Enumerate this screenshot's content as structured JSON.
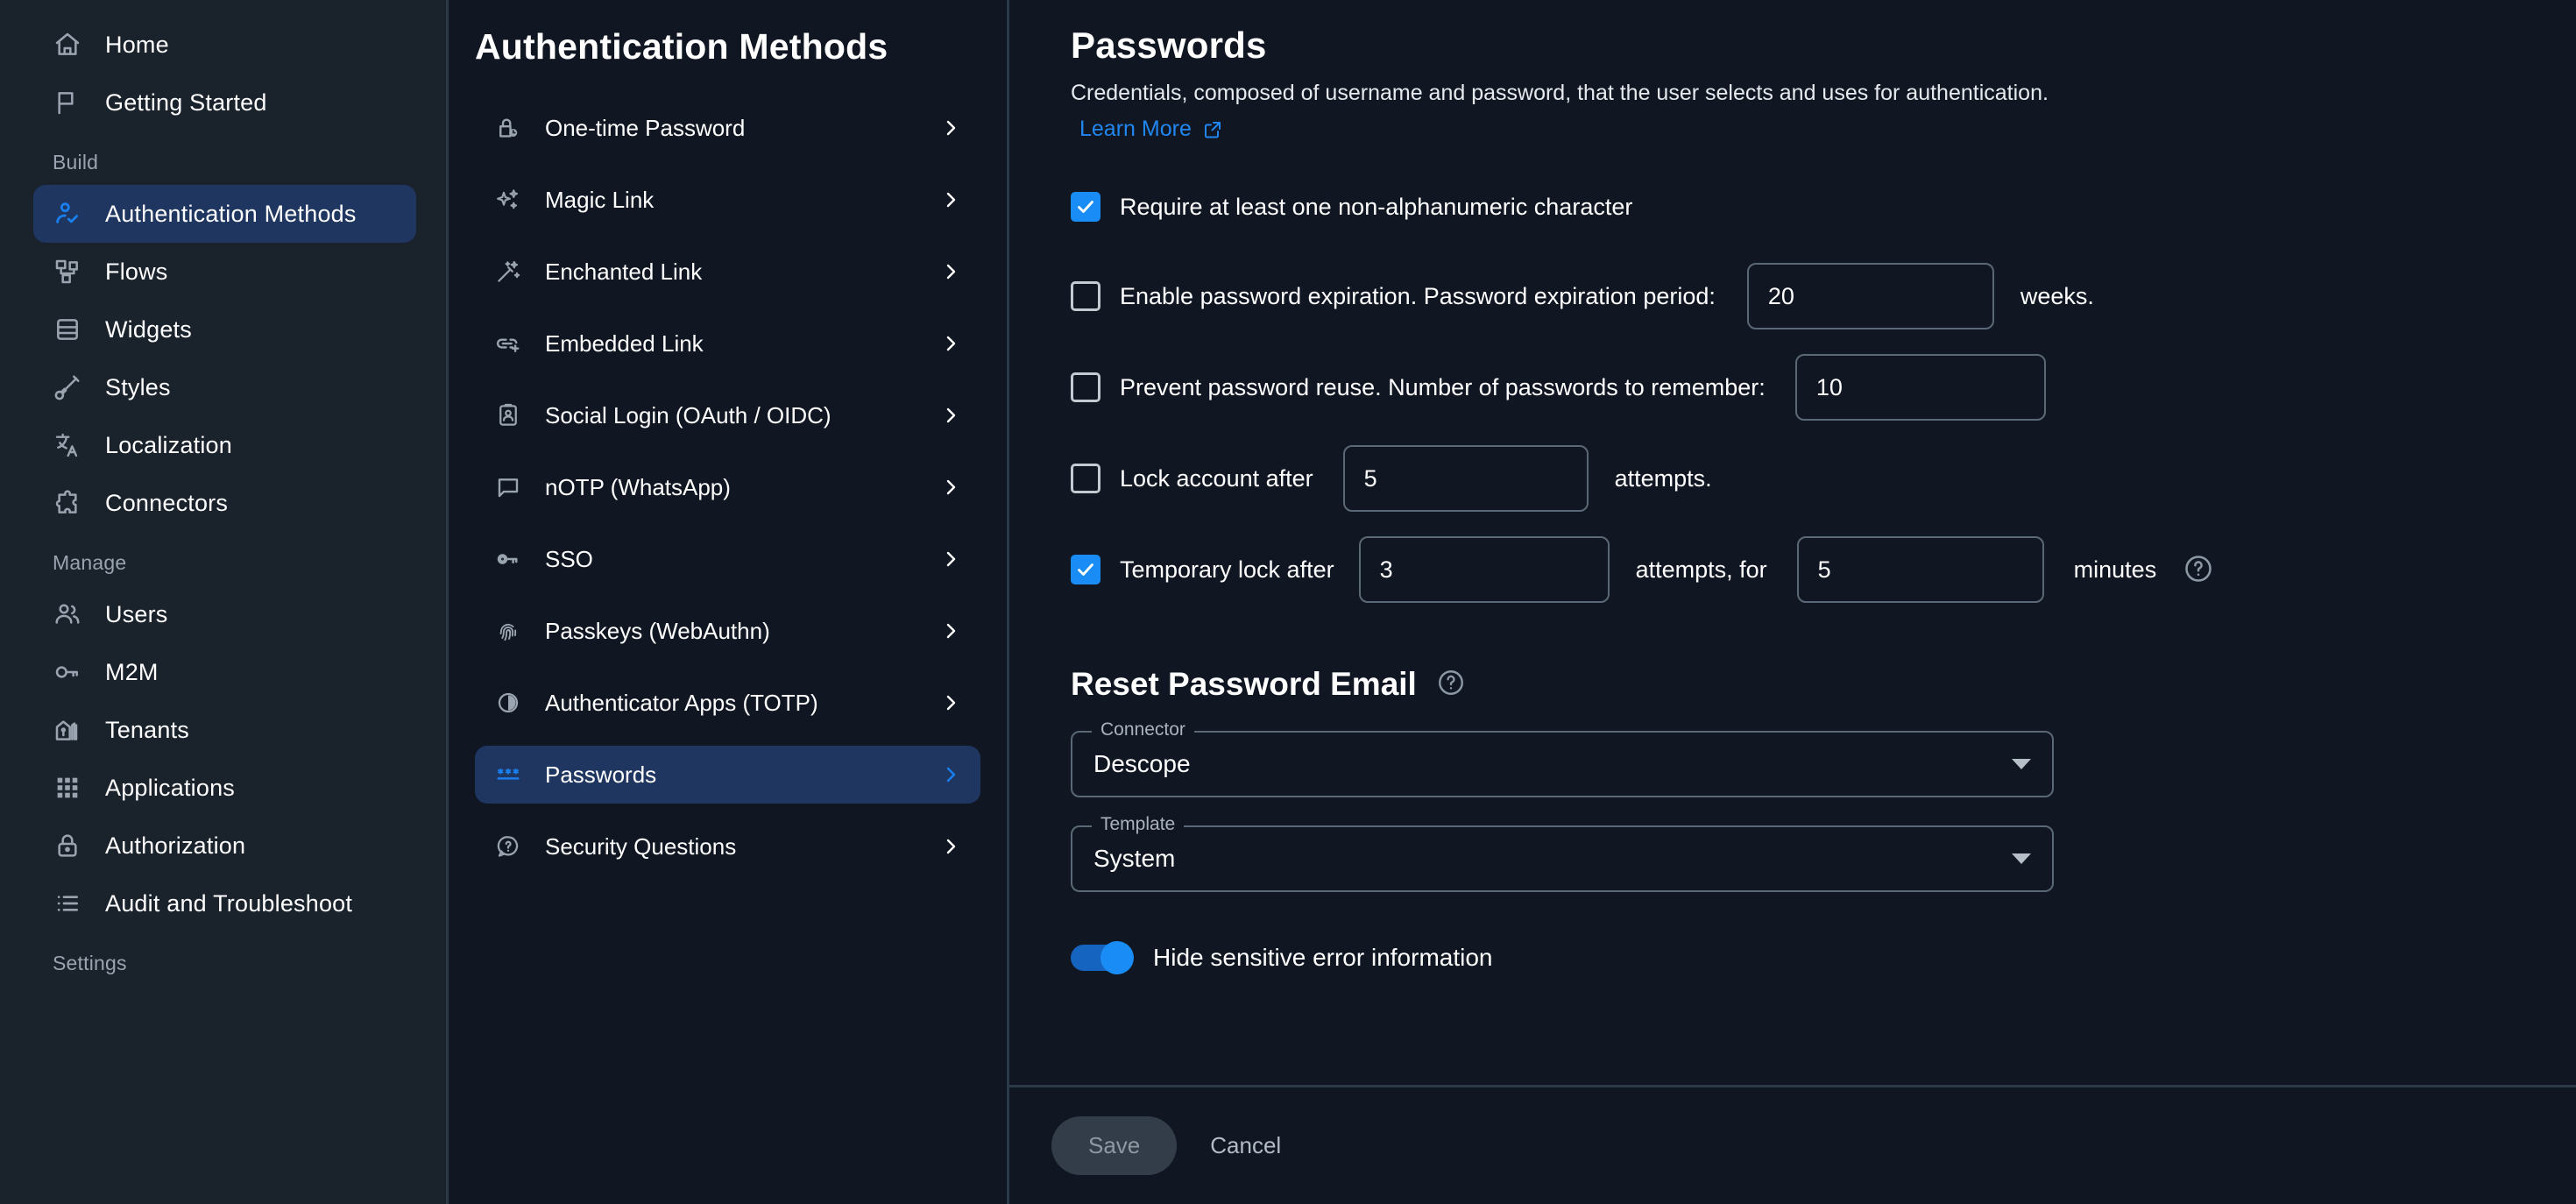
{
  "theme": {
    "sidebar_bg": "#1a222c",
    "main_bg": "#101722",
    "accent": "#1a8cf5",
    "active_item_bg": "#1e3660",
    "link": "#2186f0",
    "border": "#2c3a47"
  },
  "sidebar": {
    "top_items": [
      {
        "label": "Home",
        "icon": "home-icon"
      },
      {
        "label": "Getting Started",
        "icon": "flag-icon"
      }
    ],
    "sections": [
      {
        "title": "Build",
        "items": [
          {
            "label": "Authentication Methods",
            "icon": "user-check-icon",
            "active": true
          },
          {
            "label": "Flows",
            "icon": "flows-icon",
            "active": false
          },
          {
            "label": "Widgets",
            "icon": "widgets-icon",
            "active": false
          },
          {
            "label": "Styles",
            "icon": "brush-icon",
            "active": false
          },
          {
            "label": "Localization",
            "icon": "translate-icon",
            "active": false
          },
          {
            "label": "Connectors",
            "icon": "puzzle-icon",
            "active": false
          }
        ]
      },
      {
        "title": "Manage",
        "items": [
          {
            "label": "Users",
            "icon": "users-icon",
            "active": false
          },
          {
            "label": "M2M",
            "icon": "key-icon",
            "active": false
          },
          {
            "label": "Tenants",
            "icon": "buildings-icon",
            "active": false
          },
          {
            "label": "Applications",
            "icon": "grid-dots-icon",
            "active": false
          },
          {
            "label": "Authorization",
            "icon": "lock-icon",
            "active": false
          },
          {
            "label": "Audit and Troubleshoot",
            "icon": "list-icon",
            "active": false
          }
        ]
      },
      {
        "title": "Settings",
        "items": []
      }
    ]
  },
  "methods_panel": {
    "title": "Authentication Methods",
    "items": [
      {
        "label": "One-time Password",
        "icon": "lock-clock-icon",
        "active": false
      },
      {
        "label": "Magic Link",
        "icon": "sparkles-icon",
        "active": false
      },
      {
        "label": "Enchanted Link",
        "icon": "magic-wand-icon",
        "active": false
      },
      {
        "label": "Embedded Link",
        "icon": "link-plus-icon",
        "active": false
      },
      {
        "label": "Social Login (OAuth / OIDC)",
        "icon": "id-card-icon",
        "active": false
      },
      {
        "label": "nOTP (WhatsApp)",
        "icon": "chat-bubble-icon",
        "active": false
      },
      {
        "label": "SSO",
        "icon": "key-icon",
        "active": false
      },
      {
        "label": "Passkeys (WebAuthn)",
        "icon": "fingerprint-icon",
        "active": false
      },
      {
        "label": "Authenticator Apps (TOTP)",
        "icon": "totp-clock-icon",
        "active": false
      },
      {
        "label": "Passwords",
        "icon": "asterisks-icon",
        "active": true
      },
      {
        "label": "Security Questions",
        "icon": "question-chat-icon",
        "active": false
      }
    ],
    "chevron_icon": "chevron-right-icon"
  },
  "main": {
    "title": "Passwords",
    "description": "Credentials, composed of username and password, that the user selects and uses for authentication.",
    "learn_more": "Learn More",
    "learn_more_icon": "external-link-icon",
    "options": [
      {
        "id": "non-alphanumeric",
        "checked": true,
        "label": "Require at least one non-alphanumeric character"
      },
      {
        "id": "password-expiration",
        "checked": false,
        "label": "Enable password expiration. Password expiration period:",
        "value": "20",
        "suffix": "weeks."
      },
      {
        "id": "prevent-reuse",
        "checked": false,
        "label": "Prevent password reuse. Number of passwords to remember:",
        "value": "10"
      },
      {
        "id": "lock-account",
        "checked": false,
        "label": "Lock account after",
        "value": "5",
        "suffix": "attempts."
      },
      {
        "id": "temporary-lock",
        "checked": true,
        "label": "Temporary lock after",
        "value": "3",
        "mid_suffix": "attempts, for",
        "value2": "5",
        "suffix": "minutes",
        "help_icon": "help-circle-icon"
      }
    ],
    "reset_section": {
      "title": "Reset Password Email",
      "help_icon": "help-circle-icon",
      "connector": {
        "legend": "Connector",
        "value": "Descope"
      },
      "template": {
        "legend": "Template",
        "value": "System"
      }
    },
    "toggle": {
      "label": "Hide sensitive error information",
      "on": true
    },
    "footer": {
      "save_label": "Save",
      "cancel_label": "Cancel"
    }
  }
}
